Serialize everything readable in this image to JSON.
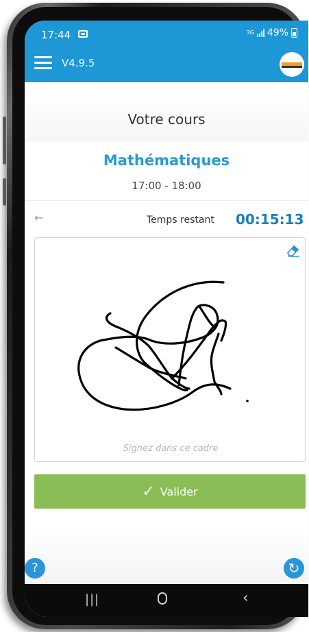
{
  "status_bar": {
    "time": "17:44",
    "network": "3G",
    "battery": "49%"
  },
  "app_bar": {
    "version": "V4.9.5"
  },
  "course": {
    "heading": "Votre cours",
    "subject": "Mathématiques",
    "hours": "17:00 - 18:00"
  },
  "timer": {
    "label": "Temps restant",
    "value": "00:15:13"
  },
  "signature": {
    "placeholder": "Signez dans ce cadre"
  },
  "actions": {
    "validate_label": "Valider",
    "help_label": "?"
  },
  "colors": {
    "primary": "#1d97d6",
    "subject": "#2a9bd2",
    "timer": "#1d7fb6",
    "validate": "#8bbd56"
  },
  "icons": {
    "menu": "hamburger-icon",
    "back": "arrow-left-icon",
    "eraser": "eraser-icon",
    "refresh": "refresh-icon",
    "help": "question-icon"
  }
}
